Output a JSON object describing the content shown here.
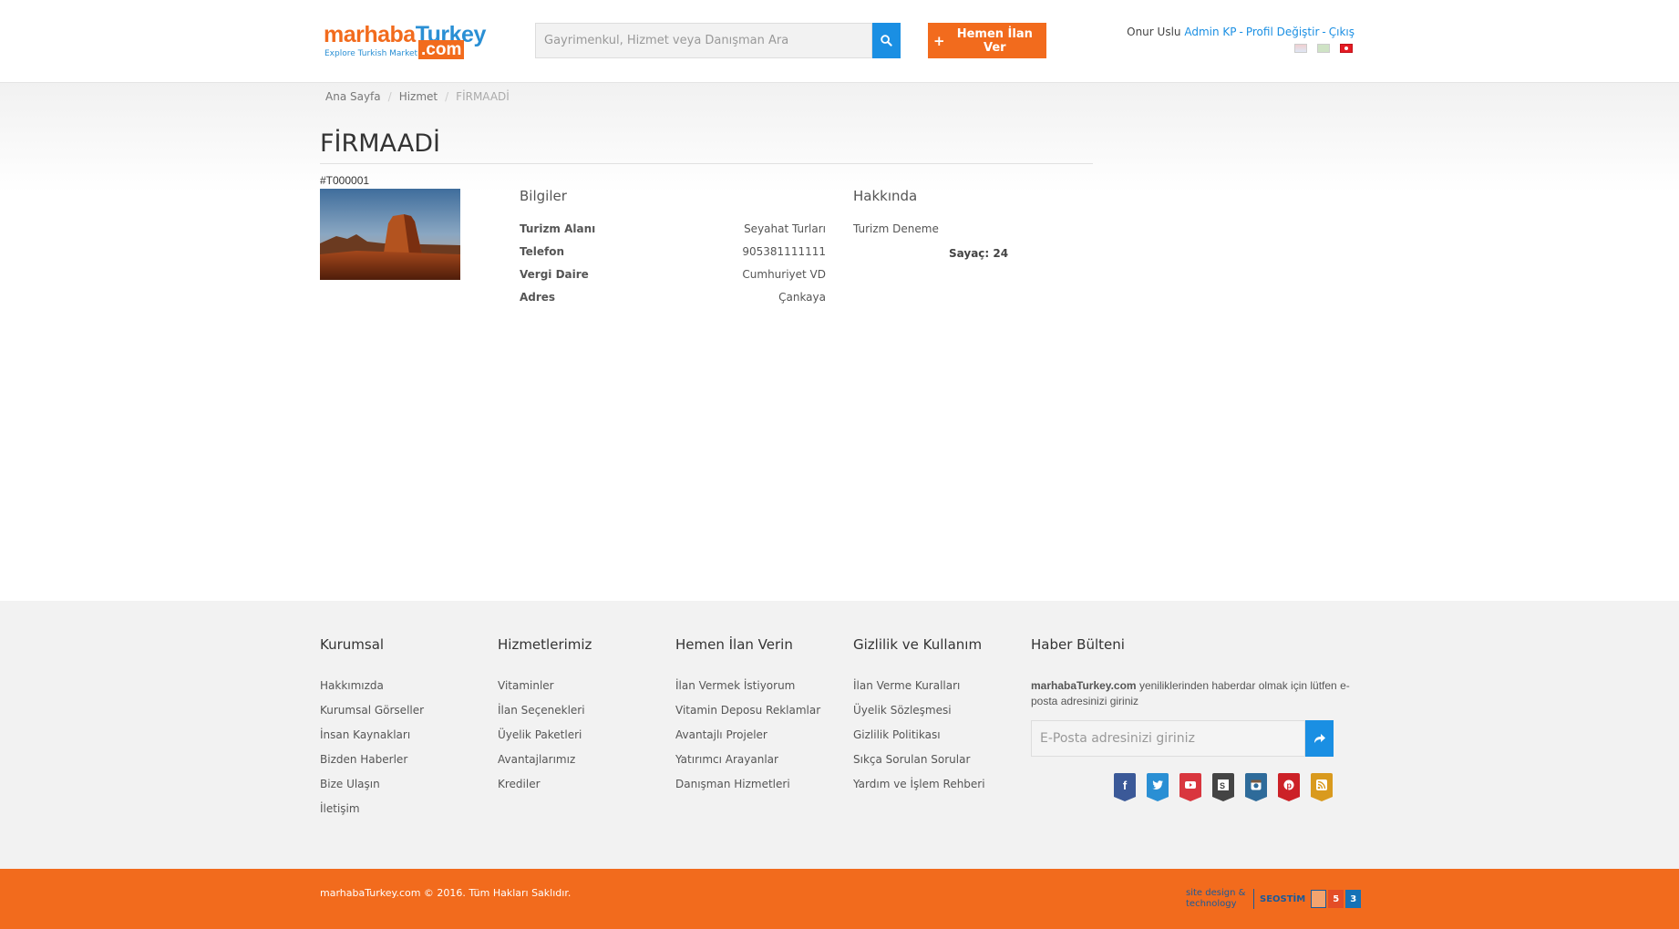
{
  "header": {
    "logo": {
      "part1": "marhaba",
      "part2": "Turkey",
      "domain": ".com",
      "tagline": "Explore Turkish Market"
    },
    "search": {
      "placeholder": "Gayrimenkul, Hizmet veya Danışman Ara",
      "value": "",
      "icon": "search-icon"
    },
    "post_button": {
      "label": "Hemen İlan Ver",
      "icon": "plus-icon"
    },
    "user": {
      "name": "Onur Uslu",
      "links": [
        "Admin KP",
        "Profil Değiştir",
        "Çıkış"
      ],
      "separator": "-"
    },
    "languages": [
      "english-flag",
      "arabic-flag",
      "turkish-flag"
    ]
  },
  "breadcrumb": {
    "items": [
      "Ana Sayfa",
      "Hizmet"
    ],
    "current": "FİRMAADİ",
    "divider": "/"
  },
  "company": {
    "title": "FİRMAADİ",
    "code": "#T000001",
    "info_heading": "Bilgiler",
    "info": [
      {
        "key": "Turizm Alanı",
        "value": "Seyahat Turları"
      },
      {
        "key": "Telefon",
        "value": "905381111111"
      },
      {
        "key": "Vergi Daire",
        "value": "Cumhuriyet VD"
      },
      {
        "key": "Adres",
        "value": "Çankaya"
      }
    ],
    "about_heading": "Hakkında",
    "about_text": "Turizm Deneme",
    "counter_label": "Sayaç:",
    "counter_value": "24"
  },
  "footer": {
    "columns": [
      {
        "heading": "Kurumsal",
        "links": [
          "Hakkımızda",
          "Kurumsal Görseller",
          "İnsan Kaynakları",
          "Bizden Haberler",
          "Bize Ulaşın",
          "İletişim"
        ]
      },
      {
        "heading": "Hizmetlerimiz",
        "links": [
          "Vitaminler",
          "İlan Seçenekleri",
          "Üyelik Paketleri",
          "Avantajlarımız",
          "Krediler"
        ]
      },
      {
        "heading": "Hemen İlan Verin",
        "links": [
          "İlan Vermek İstiyorum",
          "Vitamin Deposu Reklamlar",
          "Avantajlı Projeler",
          "Yatırımcı Arayanlar",
          "Danışman Hizmetleri"
        ]
      },
      {
        "heading": "Gizlilik ve Kullanım",
        "links": [
          "İlan Verme Kuralları",
          "Üyelik Sözleşmesi",
          "Gizlilik Politikası",
          "Sıkça Sorulan Sorular",
          "Yardım ve İşlem Rehberi"
        ]
      }
    ],
    "newsletter": {
      "heading": "Haber Bülteni",
      "brand": "marhabaTurkey.com",
      "text": " yeniliklerinden haberdar olmak için lütfen e-posta adresinizi giriniz",
      "placeholder": "E-Posta adresinizi giriniz",
      "button_icon": "share-arrow-icon"
    },
    "social": [
      {
        "name": "facebook-icon",
        "color": "#3b5998"
      },
      {
        "name": "twitter-icon",
        "color": "#2a8fd4"
      },
      {
        "name": "youtube-icon",
        "color": "#d9363e"
      },
      {
        "name": "stumbleupon-icon",
        "color": "#444444"
      },
      {
        "name": "instagram-icon",
        "color": "#2e6b9a"
      },
      {
        "name": "pinterest-icon",
        "color": "#cc2127"
      },
      {
        "name": "rss-icon",
        "color": "#d99a1e"
      }
    ]
  },
  "bottom": {
    "copyright": "marhabaTurkey.com © 2016. Tüm Hakları Saklıdır.",
    "credit_caption": "site design & technology",
    "credit_brand": "SEOSTİM"
  },
  "colors": {
    "accent_orange": "#f26b1d",
    "accent_blue": "#1a8fe3",
    "footer_bg": "#f2f2f2"
  }
}
